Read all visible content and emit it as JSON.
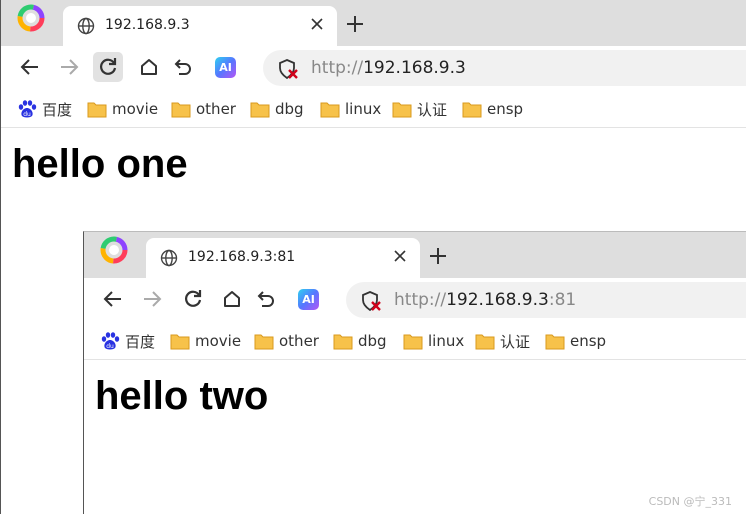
{
  "window1": {
    "tab_title": "192.168.9.3",
    "url": {
      "protocol": "http://",
      "host": "192.168.9.3",
      "port": ""
    },
    "bookmarks": [
      "百度",
      "movie",
      "other",
      "dbg",
      "linux",
      "认证",
      "ensp"
    ],
    "heading": "hello one"
  },
  "window2": {
    "tab_title": "192.168.9.3:81",
    "url": {
      "protocol": "http://",
      "host": "192.168.9.3",
      "port": ":81"
    },
    "bookmarks": [
      "百度",
      "movie",
      "other",
      "dbg",
      "linux",
      "认证",
      "ensp"
    ],
    "heading": "hello two"
  },
  "ai_label": "AI",
  "watermark": "CSDN @宁_331",
  "colors": {
    "titlebar": "#dedede",
    "address_bar": "#f1f1f1",
    "folder": "#f7c24a",
    "baidu": "#2932e1",
    "shield_x": "#d0021b"
  },
  "icons": [
    "browser-logo-icon",
    "globe-icon",
    "close-icon",
    "plus-icon",
    "back-arrow-icon",
    "forward-arrow-icon",
    "reload-icon",
    "home-icon",
    "undo-icon",
    "ai-icon",
    "shield-warning-icon",
    "baidu-paw-icon",
    "folder-icon"
  ]
}
